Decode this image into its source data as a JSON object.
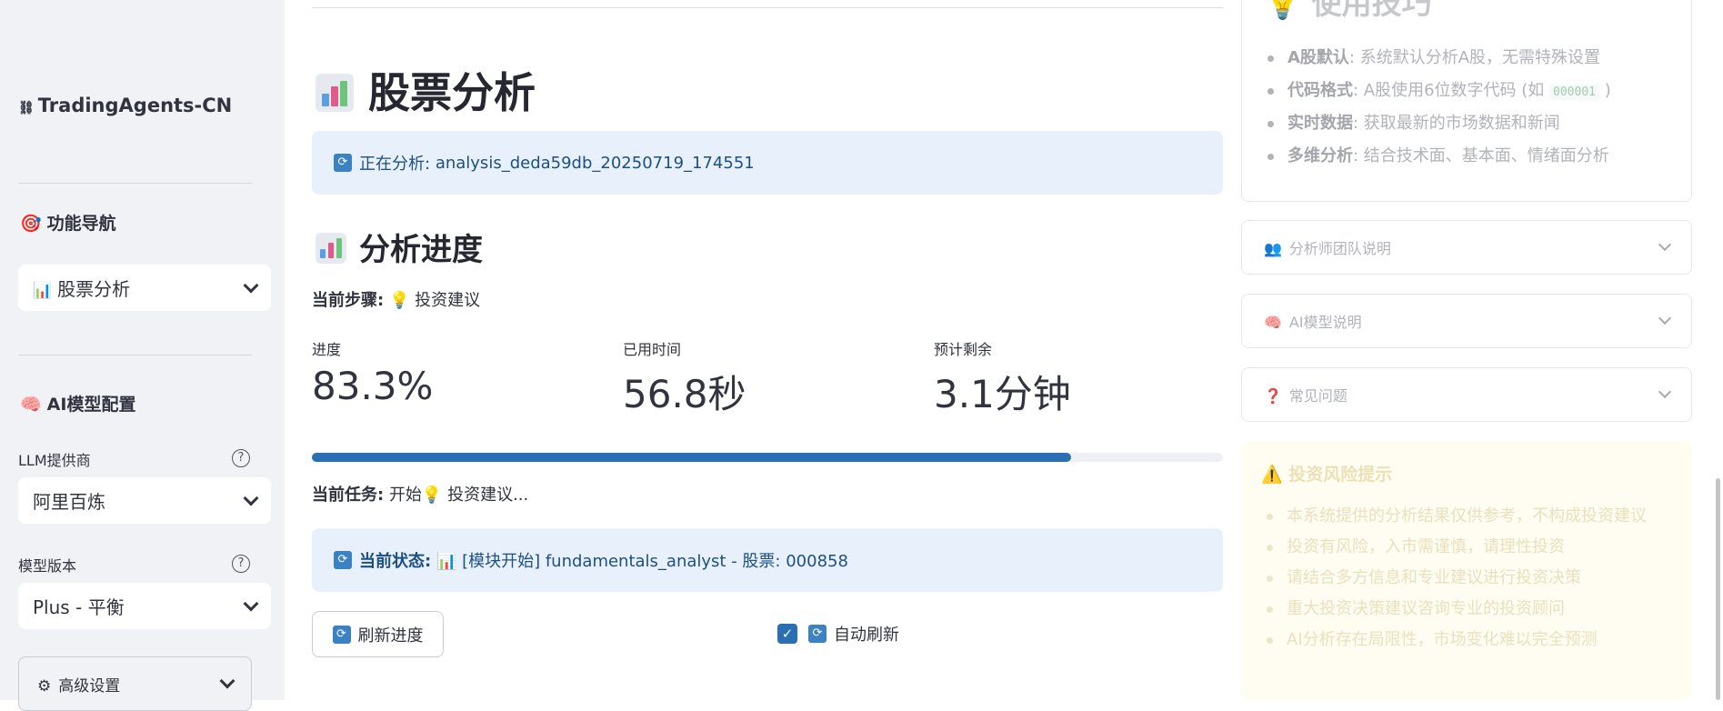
{
  "sidebar": {
    "brand": "TradingAgents-CN",
    "brand_icon": "link-icon",
    "nav_heading": "功能导航",
    "nav_icon": "target-icon",
    "nav_select": {
      "value": "股票分析",
      "icon": "bar-chart-icon"
    },
    "ai_heading": "AI模型配置",
    "ai_icon": "brain-icon",
    "llm_label": "LLM提供商",
    "llm_value": "阿里百炼",
    "model_label": "模型版本",
    "model_value": "Plus - 平衡",
    "advanced": "高级设置",
    "help_glyph": "?"
  },
  "main": {
    "title": "股票分析",
    "analyzing_label": "正在分析:",
    "analysis_id": "analysis_deda59db_20250719_174551",
    "progress_heading": "分析进度",
    "step_label": "当前步骤:",
    "step_value": "💡 投资建议",
    "metrics": [
      {
        "label": "进度",
        "value": "83.3%"
      },
      {
        "label": "已用时间",
        "value": "56.8秒"
      },
      {
        "label": "预计剩余",
        "value": "3.1分钟"
      }
    ],
    "progress_fraction": 0.833,
    "task_label": "当前任务:",
    "task_value": "开始💡 投资建议...",
    "status_label": "当前状态:",
    "status_value": "📊 [模块开始] fundamentals_analyst - 股票: 000858",
    "refresh_button": "刷新进度",
    "auto_refresh_label": "自动刷新",
    "auto_refresh_checked": true
  },
  "right": {
    "tips_title": "使用技巧",
    "tips": [
      {
        "bold": "A股默认",
        "text": ": 系统默认分析A股，无需特殊设置"
      },
      {
        "bold": "代码格式",
        "text": ": A股使用6位数字代码 (如 ",
        "code": "000001",
        "tail": " )"
      },
      {
        "bold": "实时数据",
        "text": ": 获取最新的市场数据和新闻"
      },
      {
        "bold": "多维分析",
        "text": ": 结合技术面、基本面、情绪面分析"
      }
    ],
    "expanders": [
      {
        "label": "分析师团队说明",
        "icon": "people-icon",
        "glyph": "👥"
      },
      {
        "label": "AI模型说明",
        "icon": "brain-icon",
        "glyph": "🧠"
      },
      {
        "label": "常见问题",
        "icon": "question-icon",
        "glyph": "❓"
      }
    ],
    "risk_title": "投资风险提示",
    "risks": [
      "本系统提供的分析结果仅供参考，不构成投资建议",
      "投资有风险，入市需谨慎，请理性投资",
      "请结合多方信息和专业建议进行投资决策",
      "重大投资决策建议咨询专业的投资顾问",
      "AI分析存在局限性，市场变化难以完全预测"
    ]
  },
  "colors": {
    "accent": "#2a6fb3",
    "info_bg": "#e8f1fb",
    "info_text": "#1c4f82",
    "sidebar_bg": "#f0f2f6"
  }
}
